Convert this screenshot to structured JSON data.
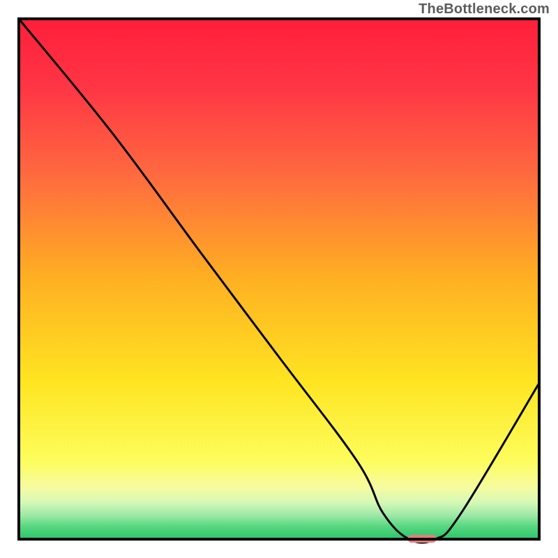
{
  "watermark": "TheBottleneck.com",
  "chart_data": {
    "type": "line",
    "title": "",
    "xlabel": "",
    "ylabel": "",
    "xlim": [
      0,
      100
    ],
    "ylim": [
      0,
      100
    ],
    "series": [
      {
        "name": "bottleneck-curve",
        "x": [
          0,
          18,
          35,
          50,
          65,
          70,
          75,
          80,
          85,
          100
        ],
        "values": [
          100,
          78,
          55,
          35,
          15,
          5,
          0,
          0,
          5,
          30
        ]
      }
    ],
    "marker": {
      "name": "optimal-point",
      "x": 77.5,
      "y": 0,
      "width": 5.5,
      "color": "#ee7a7a"
    },
    "background_gradient": {
      "stops": [
        {
          "pos": 0.0,
          "color": "#ff1f3a"
        },
        {
          "pos": 0.13,
          "color": "#ff3545"
        },
        {
          "pos": 0.3,
          "color": "#ff6a3f"
        },
        {
          "pos": 0.5,
          "color": "#ffb022"
        },
        {
          "pos": 0.7,
          "color": "#ffe522"
        },
        {
          "pos": 0.85,
          "color": "#fdfd5d"
        },
        {
          "pos": 0.9,
          "color": "#f6fca0"
        },
        {
          "pos": 0.93,
          "color": "#d4f8b6"
        },
        {
          "pos": 0.955,
          "color": "#9be8a6"
        },
        {
          "pos": 0.975,
          "color": "#58d780"
        },
        {
          "pos": 1.0,
          "color": "#2bc56a"
        }
      ]
    },
    "frame_color": "#000000",
    "line_color": "#000000"
  }
}
